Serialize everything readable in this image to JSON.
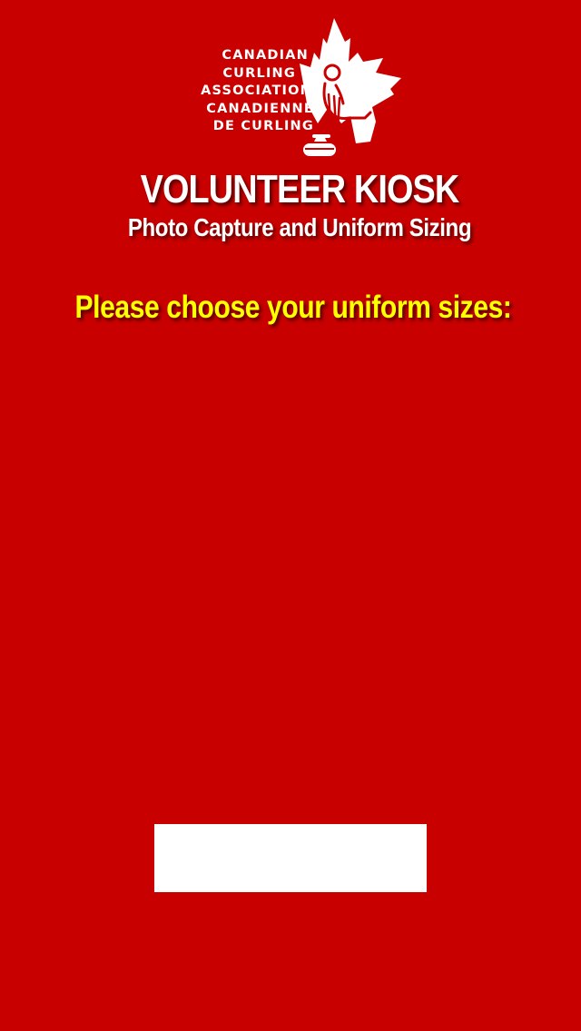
{
  "logo": {
    "name": "canadian-curling-association-logo",
    "lines": [
      "CANADIAN",
      "CURLING",
      "ASSOCIATION",
      "CANADIENNE",
      "DE CURLING"
    ]
  },
  "header": {
    "title": "VOLUNTEER KIOSK",
    "subtitle": "Photo Capture and Uniform Sizing"
  },
  "main": {
    "prompt": "Please choose your uniform sizes:",
    "continue_button_label": ""
  },
  "colors": {
    "background": "#c80000",
    "title_text": "#ffffff",
    "prompt_text": "#ffff00",
    "button": "#ffffff"
  }
}
